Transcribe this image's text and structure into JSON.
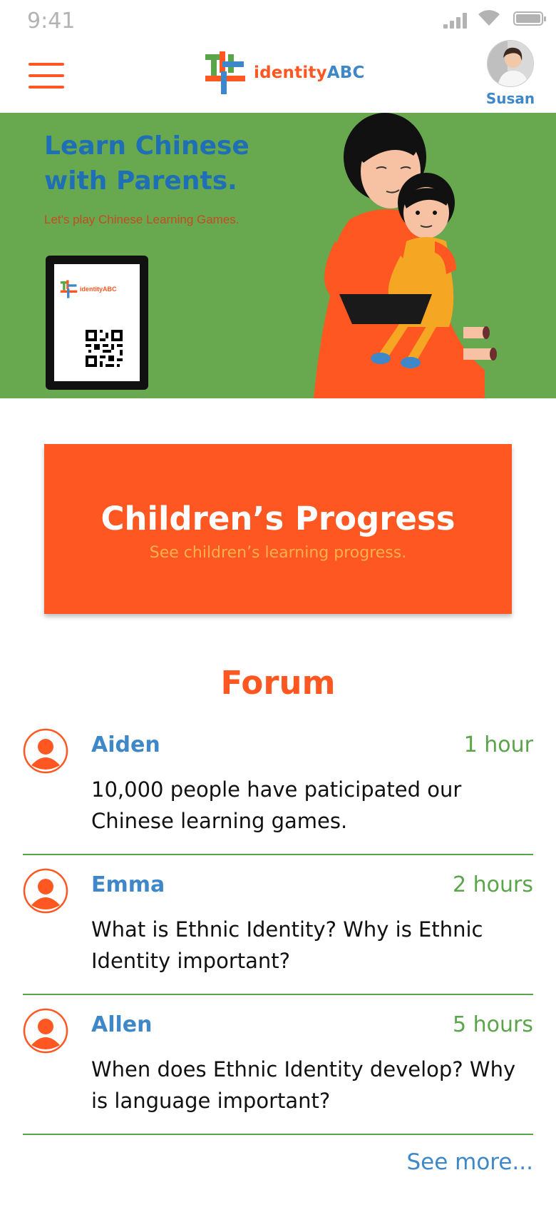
{
  "status_bar": {
    "time": "9:41"
  },
  "header": {
    "logo_text_part1": "identity",
    "logo_text_part2": "ABC",
    "user_name": "Susan"
  },
  "banner": {
    "title": "Learn Chinese with Parents.",
    "subtitle": "Let's play Chinese Learning Games.",
    "tablet_logo_text": "identityABC"
  },
  "progress_card": {
    "title": "Children’s Progress",
    "subtitle": "See children’s learning progress."
  },
  "forum": {
    "title": "Forum",
    "posts": [
      {
        "author": "Aiden",
        "time": "1 hour",
        "text": "10,000 people have paticipated our Chinese learning games."
      },
      {
        "author": "Emma",
        "time": "2 hours",
        "text": "What is Ethnic Identity?  Why is Ethnic Identity important?"
      },
      {
        "author": "Allen",
        "time": "5 hours",
        "text": "When does Ethnic Identity develop? Why is language important?"
      }
    ],
    "see_more": "See more..."
  },
  "colors": {
    "accent_orange": "#ff5722",
    "blue": "#3e88c9",
    "green": "#68a84f",
    "divider_green": "#5aa54a"
  },
  "icons": [
    "menu-icon",
    "user-avatar-icon",
    "signal-icon",
    "wifi-icon",
    "battery-icon",
    "qr-code-icon"
  ]
}
